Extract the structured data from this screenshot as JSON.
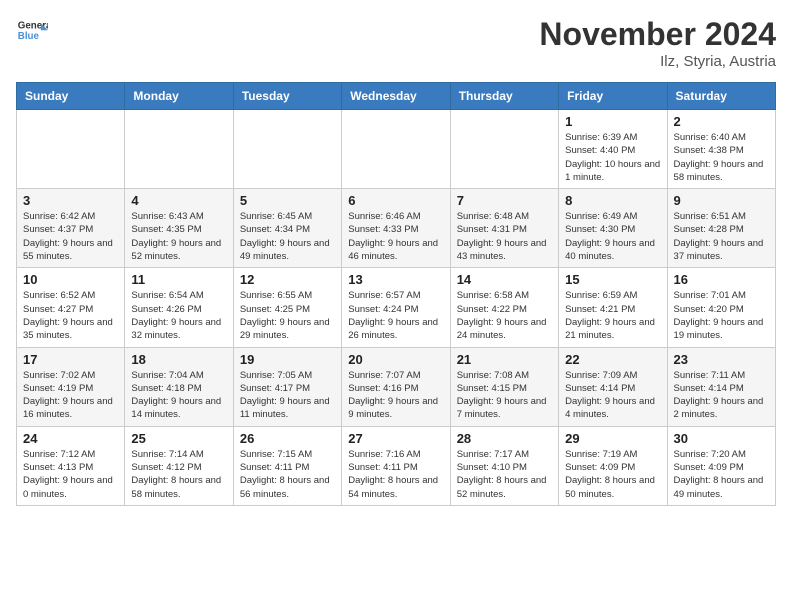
{
  "header": {
    "logo_line1": "General",
    "logo_line2": "Blue",
    "title": "November 2024",
    "subtitle": "Ilz, Styria, Austria"
  },
  "weekdays": [
    "Sunday",
    "Monday",
    "Tuesday",
    "Wednesday",
    "Thursday",
    "Friday",
    "Saturday"
  ],
  "weeks": [
    [
      {
        "day": "",
        "info": ""
      },
      {
        "day": "",
        "info": ""
      },
      {
        "day": "",
        "info": ""
      },
      {
        "day": "",
        "info": ""
      },
      {
        "day": "",
        "info": ""
      },
      {
        "day": "1",
        "info": "Sunrise: 6:39 AM\nSunset: 4:40 PM\nDaylight: 10 hours and 1 minute."
      },
      {
        "day": "2",
        "info": "Sunrise: 6:40 AM\nSunset: 4:38 PM\nDaylight: 9 hours and 58 minutes."
      }
    ],
    [
      {
        "day": "3",
        "info": "Sunrise: 6:42 AM\nSunset: 4:37 PM\nDaylight: 9 hours and 55 minutes."
      },
      {
        "day": "4",
        "info": "Sunrise: 6:43 AM\nSunset: 4:35 PM\nDaylight: 9 hours and 52 minutes."
      },
      {
        "day": "5",
        "info": "Sunrise: 6:45 AM\nSunset: 4:34 PM\nDaylight: 9 hours and 49 minutes."
      },
      {
        "day": "6",
        "info": "Sunrise: 6:46 AM\nSunset: 4:33 PM\nDaylight: 9 hours and 46 minutes."
      },
      {
        "day": "7",
        "info": "Sunrise: 6:48 AM\nSunset: 4:31 PM\nDaylight: 9 hours and 43 minutes."
      },
      {
        "day": "8",
        "info": "Sunrise: 6:49 AM\nSunset: 4:30 PM\nDaylight: 9 hours and 40 minutes."
      },
      {
        "day": "9",
        "info": "Sunrise: 6:51 AM\nSunset: 4:28 PM\nDaylight: 9 hours and 37 minutes."
      }
    ],
    [
      {
        "day": "10",
        "info": "Sunrise: 6:52 AM\nSunset: 4:27 PM\nDaylight: 9 hours and 35 minutes."
      },
      {
        "day": "11",
        "info": "Sunrise: 6:54 AM\nSunset: 4:26 PM\nDaylight: 9 hours and 32 minutes."
      },
      {
        "day": "12",
        "info": "Sunrise: 6:55 AM\nSunset: 4:25 PM\nDaylight: 9 hours and 29 minutes."
      },
      {
        "day": "13",
        "info": "Sunrise: 6:57 AM\nSunset: 4:24 PM\nDaylight: 9 hours and 26 minutes."
      },
      {
        "day": "14",
        "info": "Sunrise: 6:58 AM\nSunset: 4:22 PM\nDaylight: 9 hours and 24 minutes."
      },
      {
        "day": "15",
        "info": "Sunrise: 6:59 AM\nSunset: 4:21 PM\nDaylight: 9 hours and 21 minutes."
      },
      {
        "day": "16",
        "info": "Sunrise: 7:01 AM\nSunset: 4:20 PM\nDaylight: 9 hours and 19 minutes."
      }
    ],
    [
      {
        "day": "17",
        "info": "Sunrise: 7:02 AM\nSunset: 4:19 PM\nDaylight: 9 hours and 16 minutes."
      },
      {
        "day": "18",
        "info": "Sunrise: 7:04 AM\nSunset: 4:18 PM\nDaylight: 9 hours and 14 minutes."
      },
      {
        "day": "19",
        "info": "Sunrise: 7:05 AM\nSunset: 4:17 PM\nDaylight: 9 hours and 11 minutes."
      },
      {
        "day": "20",
        "info": "Sunrise: 7:07 AM\nSunset: 4:16 PM\nDaylight: 9 hours and 9 minutes."
      },
      {
        "day": "21",
        "info": "Sunrise: 7:08 AM\nSunset: 4:15 PM\nDaylight: 9 hours and 7 minutes."
      },
      {
        "day": "22",
        "info": "Sunrise: 7:09 AM\nSunset: 4:14 PM\nDaylight: 9 hours and 4 minutes."
      },
      {
        "day": "23",
        "info": "Sunrise: 7:11 AM\nSunset: 4:14 PM\nDaylight: 9 hours and 2 minutes."
      }
    ],
    [
      {
        "day": "24",
        "info": "Sunrise: 7:12 AM\nSunset: 4:13 PM\nDaylight: 9 hours and 0 minutes."
      },
      {
        "day": "25",
        "info": "Sunrise: 7:14 AM\nSunset: 4:12 PM\nDaylight: 8 hours and 58 minutes."
      },
      {
        "day": "26",
        "info": "Sunrise: 7:15 AM\nSunset: 4:11 PM\nDaylight: 8 hours and 56 minutes."
      },
      {
        "day": "27",
        "info": "Sunrise: 7:16 AM\nSunset: 4:11 PM\nDaylight: 8 hours and 54 minutes."
      },
      {
        "day": "28",
        "info": "Sunrise: 7:17 AM\nSunset: 4:10 PM\nDaylight: 8 hours and 52 minutes."
      },
      {
        "day": "29",
        "info": "Sunrise: 7:19 AM\nSunset: 4:09 PM\nDaylight: 8 hours and 50 minutes."
      },
      {
        "day": "30",
        "info": "Sunrise: 7:20 AM\nSunset: 4:09 PM\nDaylight: 8 hours and 49 minutes."
      }
    ]
  ]
}
